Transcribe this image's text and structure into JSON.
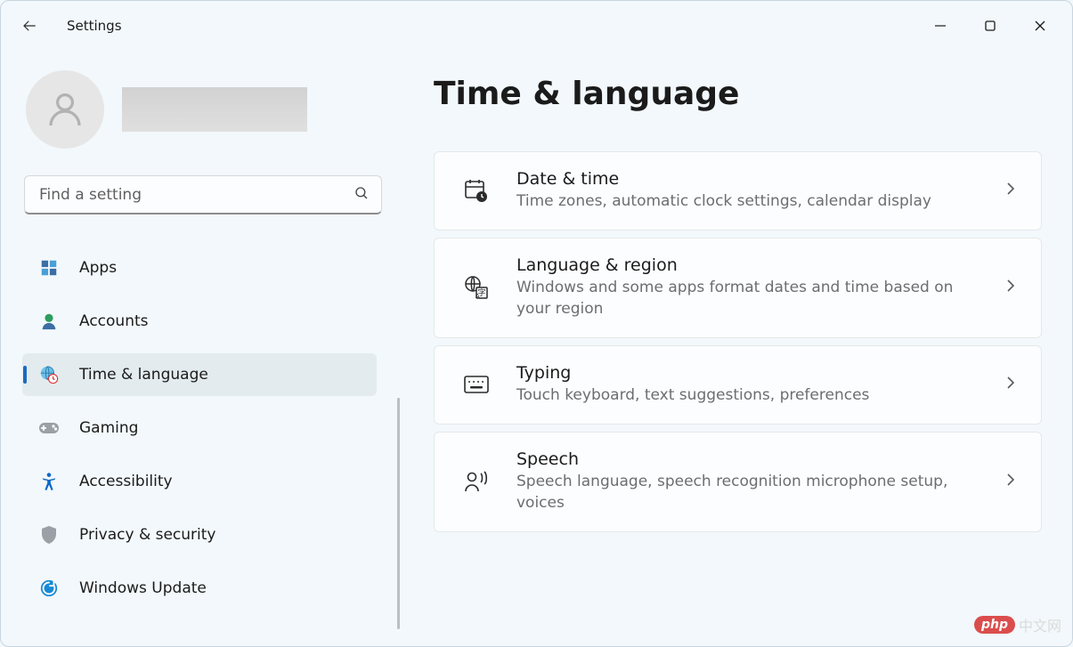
{
  "app": {
    "title": "Settings"
  },
  "search": {
    "placeholder": "Find a setting"
  },
  "sidebar": {
    "items": [
      {
        "label": "Apps",
        "icon": "apps"
      },
      {
        "label": "Accounts",
        "icon": "accounts"
      },
      {
        "label": "Time & language",
        "icon": "time-language",
        "active": true
      },
      {
        "label": "Gaming",
        "icon": "gaming"
      },
      {
        "label": "Accessibility",
        "icon": "accessibility"
      },
      {
        "label": "Privacy & security",
        "icon": "privacy"
      },
      {
        "label": "Windows Update",
        "icon": "update"
      }
    ]
  },
  "page": {
    "title": "Time & language"
  },
  "cards": [
    {
      "title": "Date & time",
      "desc": "Time zones, automatic clock settings, calendar display",
      "icon": "date-time"
    },
    {
      "title": "Language & region",
      "desc": "Windows and some apps format dates and time based on your region",
      "icon": "language-region"
    },
    {
      "title": "Typing",
      "desc": "Touch keyboard, text suggestions, preferences",
      "icon": "typing"
    },
    {
      "title": "Speech",
      "desc": "Speech language, speech recognition microphone setup, voices",
      "icon": "speech"
    }
  ],
  "watermark": {
    "badge": "php",
    "text": "中文网"
  }
}
